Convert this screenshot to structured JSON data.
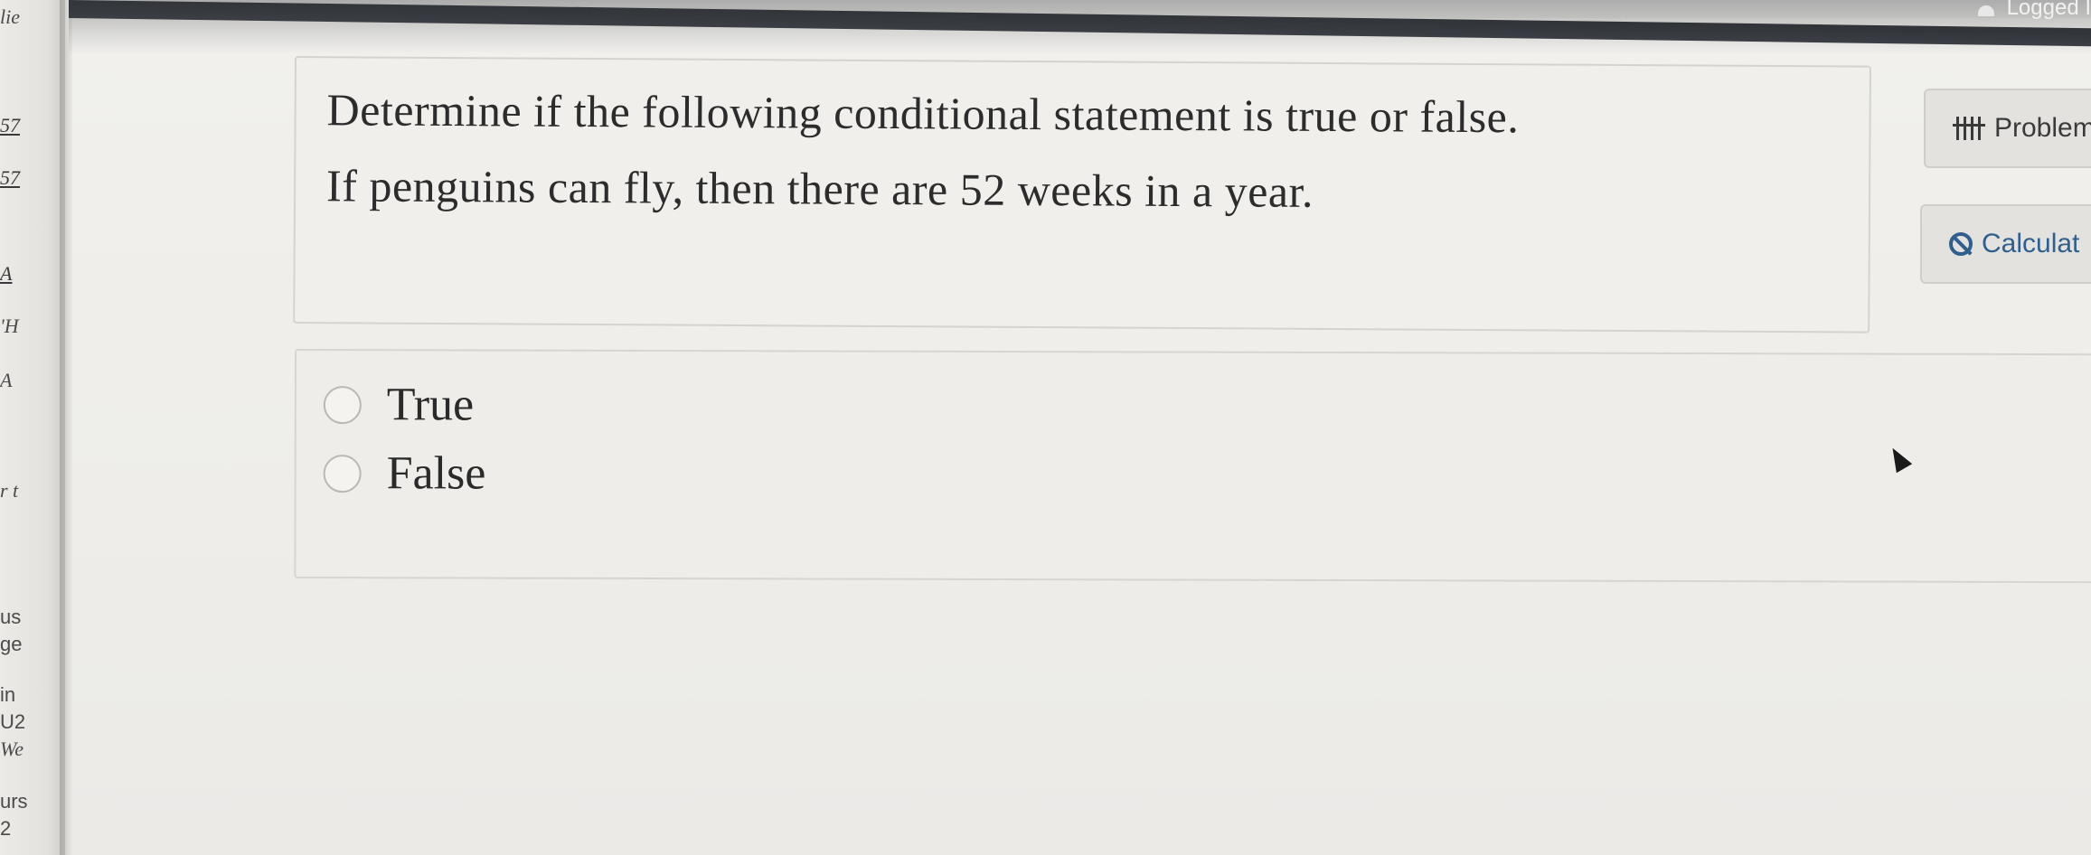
{
  "header": {
    "logged_in_label": "Logged I"
  },
  "sidebar_fragments": [
    "lie",
    "57",
    "57",
    "A",
    "'H",
    "A",
    "r t",
    "us",
    "ge",
    "in",
    "U2",
    "We",
    "urs",
    "2"
  ],
  "question": {
    "prompt": "Determine if the following conditional statement is true or false.",
    "statement": "If penguins can fly, then there are 52 weeks in a year."
  },
  "answers": {
    "options": [
      {
        "label": "True"
      },
      {
        "label": "False"
      }
    ]
  },
  "side_buttons": {
    "problem_label": "Problem",
    "calculator_label": "Calculat"
  },
  "colors": {
    "link_blue": "#2f5f8e",
    "header_dark": "#2d3136"
  }
}
